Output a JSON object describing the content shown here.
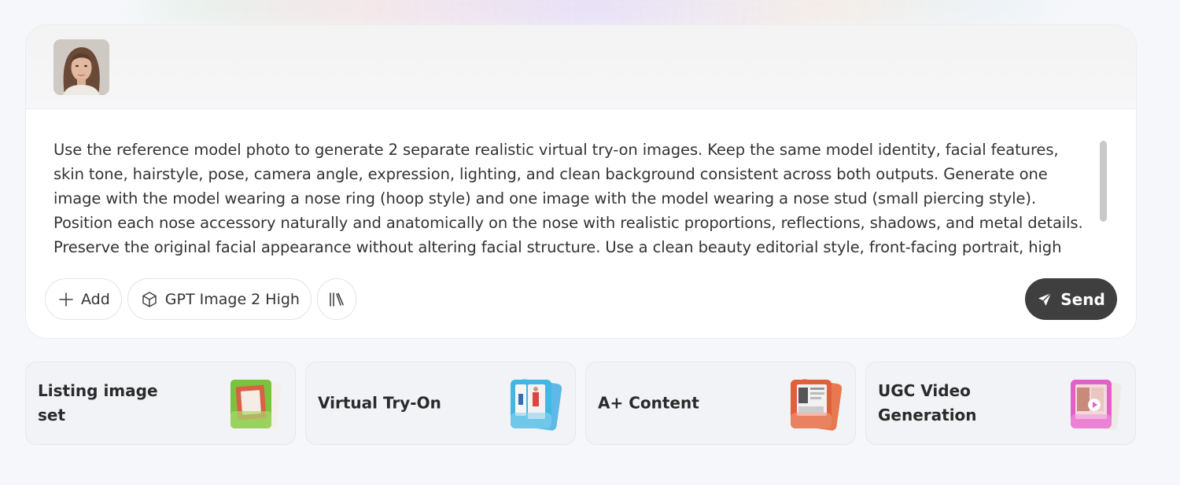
{
  "composer": {
    "attachment": {
      "name": "reference-model-photo"
    },
    "prompt": "Use the reference model photo to generate 2 separate realistic virtual try-on images. Keep the same model identity, facial features, skin tone, hairstyle, pose, camera angle, expression, lighting, and clean background consistent across both outputs. Generate one image with the model wearing a nose ring (hoop style) and one image with the model wearing a nose stud (small piercing style). Position each nose accessory naturally and anatomically on the nose with realistic proportions, reflections, shadows, and metal details. Preserve the original facial appearance without altering facial structure. Use a clean beauty editorial style, front-facing portrait, high realism, sharp focus,",
    "toolbar": {
      "add_label": "Add",
      "model_label": "GPT Image 2 High",
      "library_icon": "library-icon"
    },
    "send_label": "Send"
  },
  "cards": [
    {
      "label": "Listing image set",
      "accent": "#7cc33c"
    },
    {
      "label": "Virtual Try-On",
      "accent": "#3fb8e3"
    },
    {
      "label": "A+ Content",
      "accent": "#e0603a"
    },
    {
      "label": "UGC Video Generation",
      "accent": "#e35fc9"
    }
  ]
}
